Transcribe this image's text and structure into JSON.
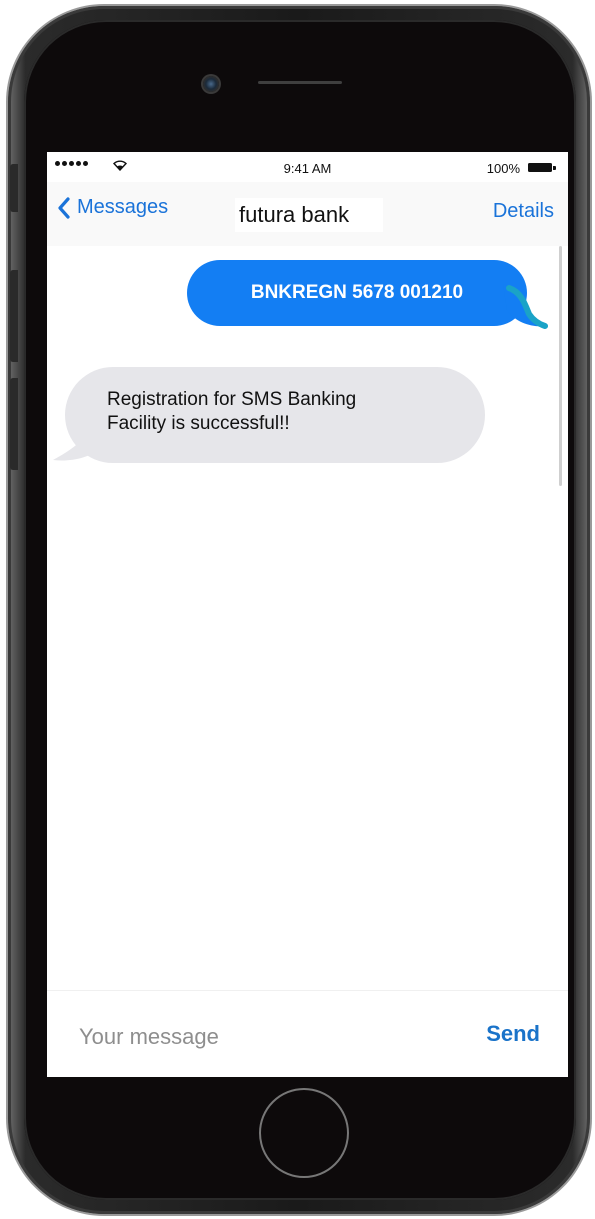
{
  "status_bar": {
    "time": "9:41 AM",
    "battery_percent": "100%",
    "signal_icon": "signal-dots-icon",
    "wifi_icon": "wifi-icon",
    "battery_icon": "battery-icon"
  },
  "nav": {
    "back_label": "Messages",
    "back_icon": "chevron-left-icon",
    "contact_name": "futura bank",
    "details_label": "Details"
  },
  "conversation": {
    "messages": [
      {
        "direction": "outgoing",
        "text": "BNKREGN 5678 001210"
      },
      {
        "direction": "incoming",
        "lines": [
          "Registration for SMS Banking",
          "Facility is successful!!"
        ]
      }
    ]
  },
  "compose": {
    "placeholder": "Your message",
    "value": "",
    "send_label": "Send"
  },
  "colors": {
    "accent": "#1a73d9",
    "outgoing_bubble": "#137ef3",
    "incoming_bubble": "#e6e6ea"
  }
}
